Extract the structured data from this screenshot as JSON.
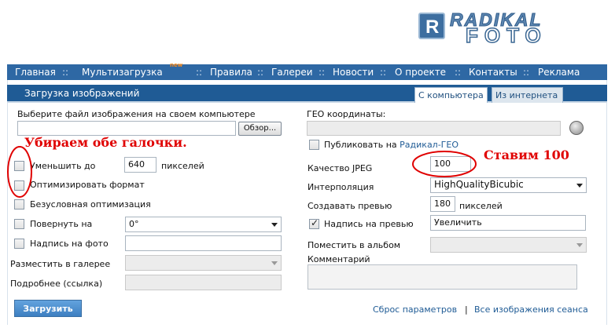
{
  "logo": {
    "box_letter": "R",
    "line1": "RADIKAL",
    "line2": "FOTO"
  },
  "nav": {
    "items": [
      "Главная",
      "Мультизагрузка",
      "Правила",
      "Галереи",
      "Новости",
      "О проекте",
      "Контакты",
      "Реклама"
    ],
    "new_badge": "new",
    "separator": "::"
  },
  "panel": {
    "title": "Загрузка изображений",
    "tabs": [
      "С компьютера",
      "Из интернета"
    ]
  },
  "left": {
    "file_label": "Выберите файл изображения на своем компьютере",
    "browse_label": "Обзор...",
    "reduce_label": "Уменьшить до",
    "reduce_value": "640",
    "reduce_unit": "пикселей",
    "optimize_label": "Оптимизировать формат",
    "unconditional_label": "Безусловная оптимизация",
    "rotate_label": "Повернуть на",
    "rotate_value": "0°",
    "caption_label": "Надпись на фото",
    "gallery_label": "Разместить в галерее",
    "more_label": "Подробнее (ссылка)"
  },
  "right": {
    "geo_label": "ГЕО координаты:",
    "publish_label": "Публиковать на",
    "publish_link": "Радикал-ГЕО",
    "jpeg_label": "Качество JPEG",
    "jpeg_value": "100",
    "interp_label": "Интерполяция",
    "interp_value": "HighQualityBicubic",
    "preview_label": "Создавать превью",
    "preview_value": "180",
    "preview_unit": "пикселей",
    "preview_caption_label": "Надпись на превью",
    "preview_caption_value": "Увеличить",
    "album_label": "Поместить в альбом",
    "comment_label": "Комментарий"
  },
  "footer": {
    "upload_label": "Загрузить",
    "reset_link": "Сброс параметров",
    "divider": "|",
    "all_images_link": "Все изображения сеанса"
  },
  "annotations": {
    "left_note": "Убираем обе галочки.",
    "right_note": "Ставим 100"
  },
  "colors": {
    "nav_bg": "#2e68a4",
    "header_bg": "#1f5b95",
    "annotation": "#e00000"
  }
}
